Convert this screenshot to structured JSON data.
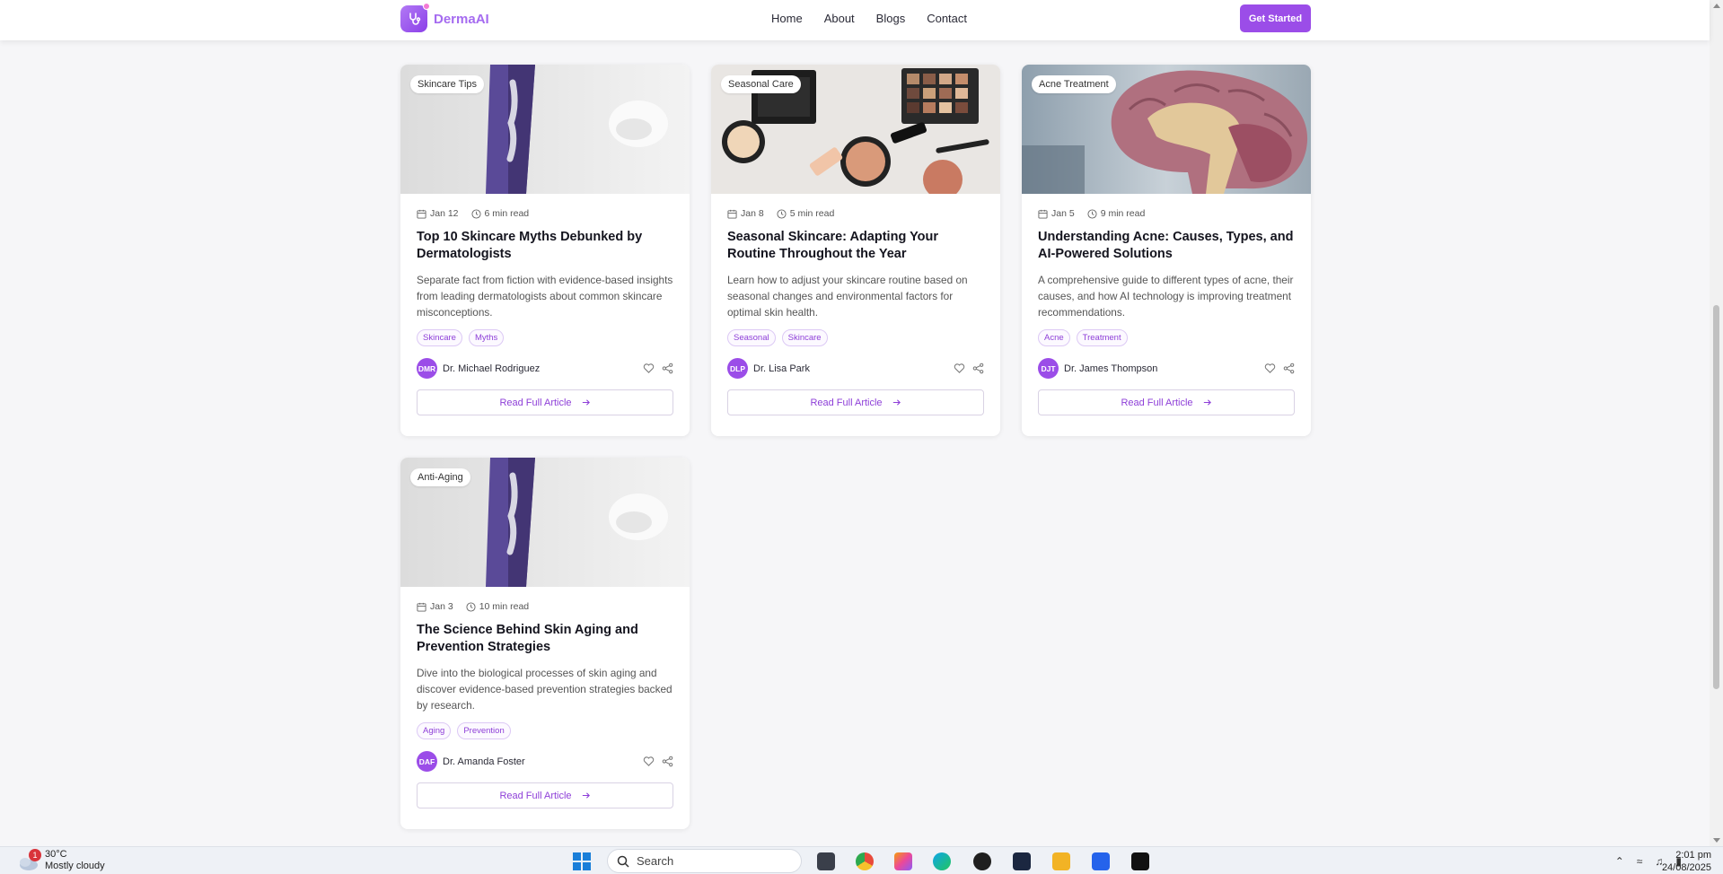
{
  "nav": {
    "brand": "DermaAI",
    "links": [
      "Home",
      "About",
      "Blogs",
      "Contact"
    ],
    "cta": "Get Started"
  },
  "colors": {
    "accent": "#9b4de8",
    "brand_text": "#a56bf0",
    "tag_text": "#8e3fd8"
  },
  "posts": [
    {
      "category": "Skincare Tips",
      "date": "Jan 12",
      "read_time": "6 min read",
      "title": "Top 10 Skincare Myths Debunked by Dermatologists",
      "excerpt": "Separate fact from fiction with evidence-based insights from leading dermatologists about common skincare misconceptions.",
      "tags": [
        "Skincare",
        "Myths"
      ],
      "initials": "DMR",
      "author": "Dr. Michael Rodriguez",
      "cta": "Read Full Article"
    },
    {
      "category": "Seasonal Care",
      "date": "Jan 8",
      "read_time": "5 min read",
      "title": "Seasonal Skincare: Adapting Your Routine Throughout the Year",
      "excerpt": "Learn how to adjust your skincare routine based on seasonal changes and environmental factors for optimal skin health.",
      "tags": [
        "Seasonal",
        "Skincare"
      ],
      "initials": "DLP",
      "author": "Dr. Lisa Park",
      "cta": "Read Full Article"
    },
    {
      "category": "Acne Treatment",
      "date": "Jan 5",
      "read_time": "9 min read",
      "title": "Understanding Acne: Causes, Types, and AI-Powered Solutions",
      "excerpt": "A comprehensive guide to different types of acne, their causes, and how AI technology is improving treatment recommendations.",
      "tags": [
        "Acne",
        "Treatment"
      ],
      "initials": "DJT",
      "author": "Dr. James Thompson",
      "cta": "Read Full Article"
    },
    {
      "category": "Anti-Aging",
      "date": "Jan 3",
      "read_time": "10 min read",
      "title": "The Science Behind Skin Aging and Prevention Strategies",
      "excerpt": "Dive into the biological processes of skin aging and discover evidence-based prevention strategies backed by research.",
      "tags": [
        "Aging",
        "Prevention"
      ],
      "initials": "DAF",
      "author": "Dr. Amanda Foster",
      "cta": "Read Full Article"
    }
  ],
  "taskbar": {
    "weather_badge": "1",
    "temperature": "30°C",
    "condition": "Mostly cloudy",
    "search": "Search",
    "time": "2:01 pm",
    "date": "24/08/2025"
  }
}
